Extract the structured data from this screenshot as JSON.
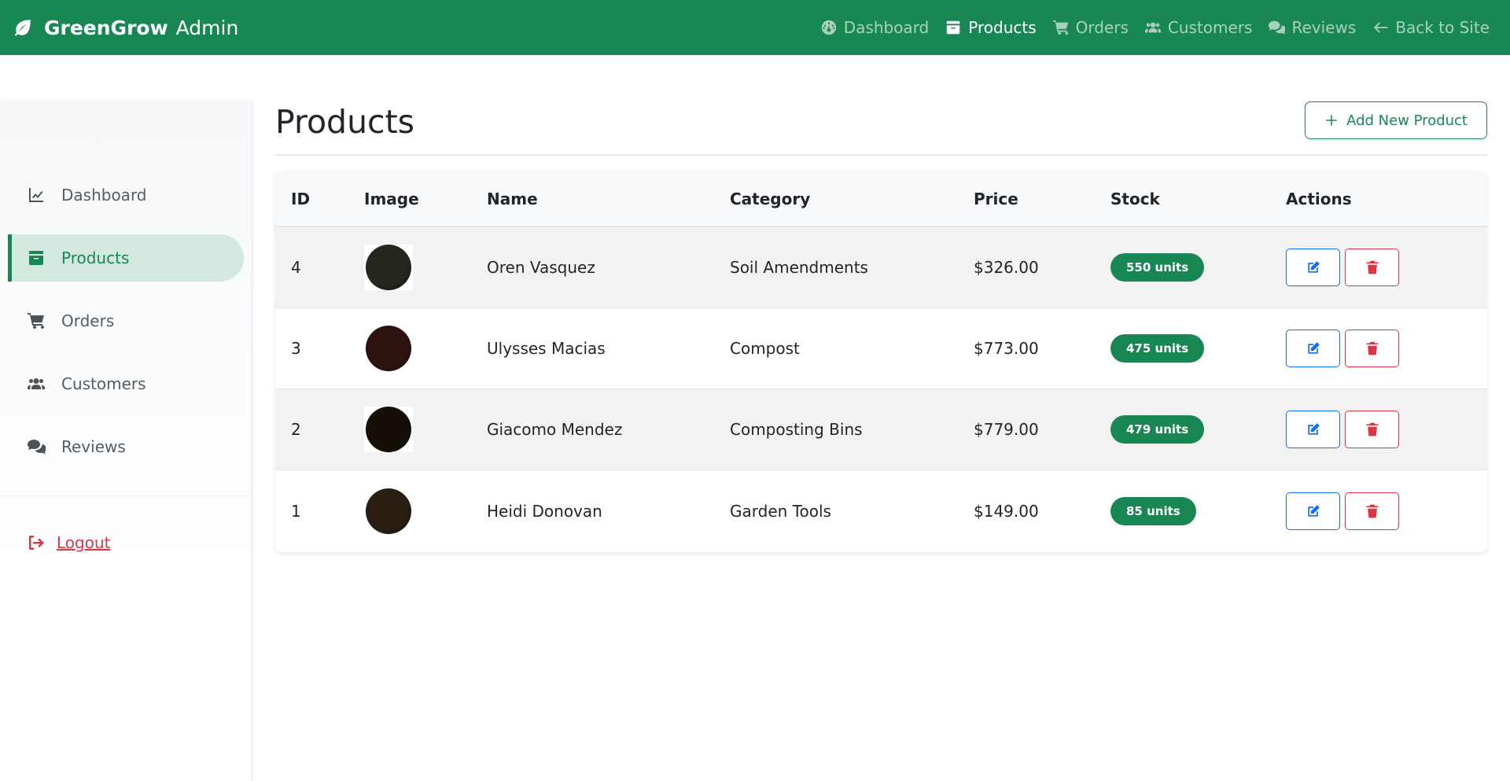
{
  "brand": {
    "name": "GreenGrow",
    "suffix": "Admin",
    "icon": "leaf-icon"
  },
  "topnav": {
    "items": [
      {
        "label": "Dashboard",
        "icon": "tachometer-icon",
        "active": false
      },
      {
        "label": "Products",
        "icon": "box-icon",
        "active": true
      },
      {
        "label": "Orders",
        "icon": "cart-icon",
        "active": false
      },
      {
        "label": "Customers",
        "icon": "users-icon",
        "active": false
      },
      {
        "label": "Reviews",
        "icon": "comments-icon",
        "active": false
      },
      {
        "label": "Back to Site",
        "icon": "arrow-left-icon",
        "active": false
      }
    ]
  },
  "sidebar": {
    "items": [
      {
        "label": "Dashboard",
        "icon": "chart-line-icon",
        "active": false
      },
      {
        "label": "Products",
        "icon": "box-icon",
        "active": true
      },
      {
        "label": "Orders",
        "icon": "cart-icon",
        "active": false
      },
      {
        "label": "Customers",
        "icon": "users-icon",
        "active": false
      },
      {
        "label": "Reviews",
        "icon": "comments-icon",
        "active": false
      }
    ],
    "logout": {
      "label": "Logout",
      "icon": "sign-out-icon"
    }
  },
  "page": {
    "title": "Products",
    "add_button": "Add New Product"
  },
  "table": {
    "headers": [
      "ID",
      "Image",
      "Name",
      "Category",
      "Price",
      "Stock",
      "Actions"
    ],
    "rows": [
      {
        "id": "4",
        "name": "Oren Vasquez",
        "category": "Soil Amendments",
        "price": "$326.00",
        "stock": "550 units",
        "image_color": "#25271f"
      },
      {
        "id": "3",
        "name": "Ulysses Macias",
        "category": "Compost",
        "price": "$773.00",
        "stock": "475 units",
        "image_color": "#2e1210"
      },
      {
        "id": "2",
        "name": "Giacomo Mendez",
        "category": "Composting Bins",
        "price": "$779.00",
        "stock": "479 units",
        "image_color": "#150f08"
      },
      {
        "id": "1",
        "name": "Heidi Donovan",
        "category": "Garden Tools",
        "price": "$149.00",
        "stock": "85 units",
        "image_color": "#2a1d12"
      }
    ]
  },
  "colors": {
    "primary": "#198754",
    "danger": "#dc3545",
    "info": "#0d6efd"
  }
}
